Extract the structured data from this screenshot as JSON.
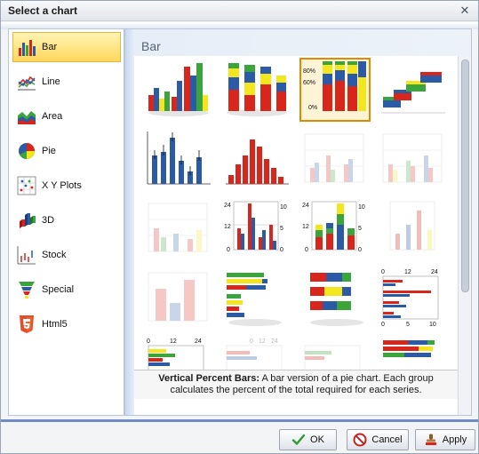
{
  "dialog": {
    "title": "Select a chart",
    "close_glyph": "✕"
  },
  "sidebar": {
    "items": [
      {
        "label": "Bar",
        "icon": "bar-chart-icon",
        "selected": true
      },
      {
        "label": "Line",
        "icon": "line-chart-icon",
        "selected": false
      },
      {
        "label": "Area",
        "icon": "area-chart-icon",
        "selected": false
      },
      {
        "label": "Pie",
        "icon": "pie-chart-icon",
        "selected": false
      },
      {
        "label": "X Y Plots",
        "icon": "xy-plot-icon",
        "selected": false
      },
      {
        "label": "3D",
        "icon": "3d-chart-icon",
        "selected": false
      },
      {
        "label": "Stock",
        "icon": "stock-chart-icon",
        "selected": false
      },
      {
        "label": "Special",
        "icon": "funnel-chart-icon",
        "selected": false
      },
      {
        "label": "Html5",
        "icon": "html5-icon",
        "selected": false
      }
    ]
  },
  "pane": {
    "title": "Bar",
    "thumb_labels": {
      "pct80": "80%",
      "pct60": "60%",
      "pct0": "0%",
      "n24": "24",
      "n12": "12",
      "n10": "10",
      "n5": "5",
      "n0": "0"
    }
  },
  "description": {
    "name": "Vertical Percent Bars:",
    "text": " A bar version of a pie chart. Each group calculates the percent of the total required for each series."
  },
  "buttons": {
    "ok": "OK",
    "cancel": "Cancel",
    "apply": "Apply"
  },
  "colors": {
    "red": "#d9261c",
    "yellow": "#f3e51e",
    "blue": "#2b5aa6",
    "green": "#3aa53a",
    "selection": "#e08a00"
  }
}
